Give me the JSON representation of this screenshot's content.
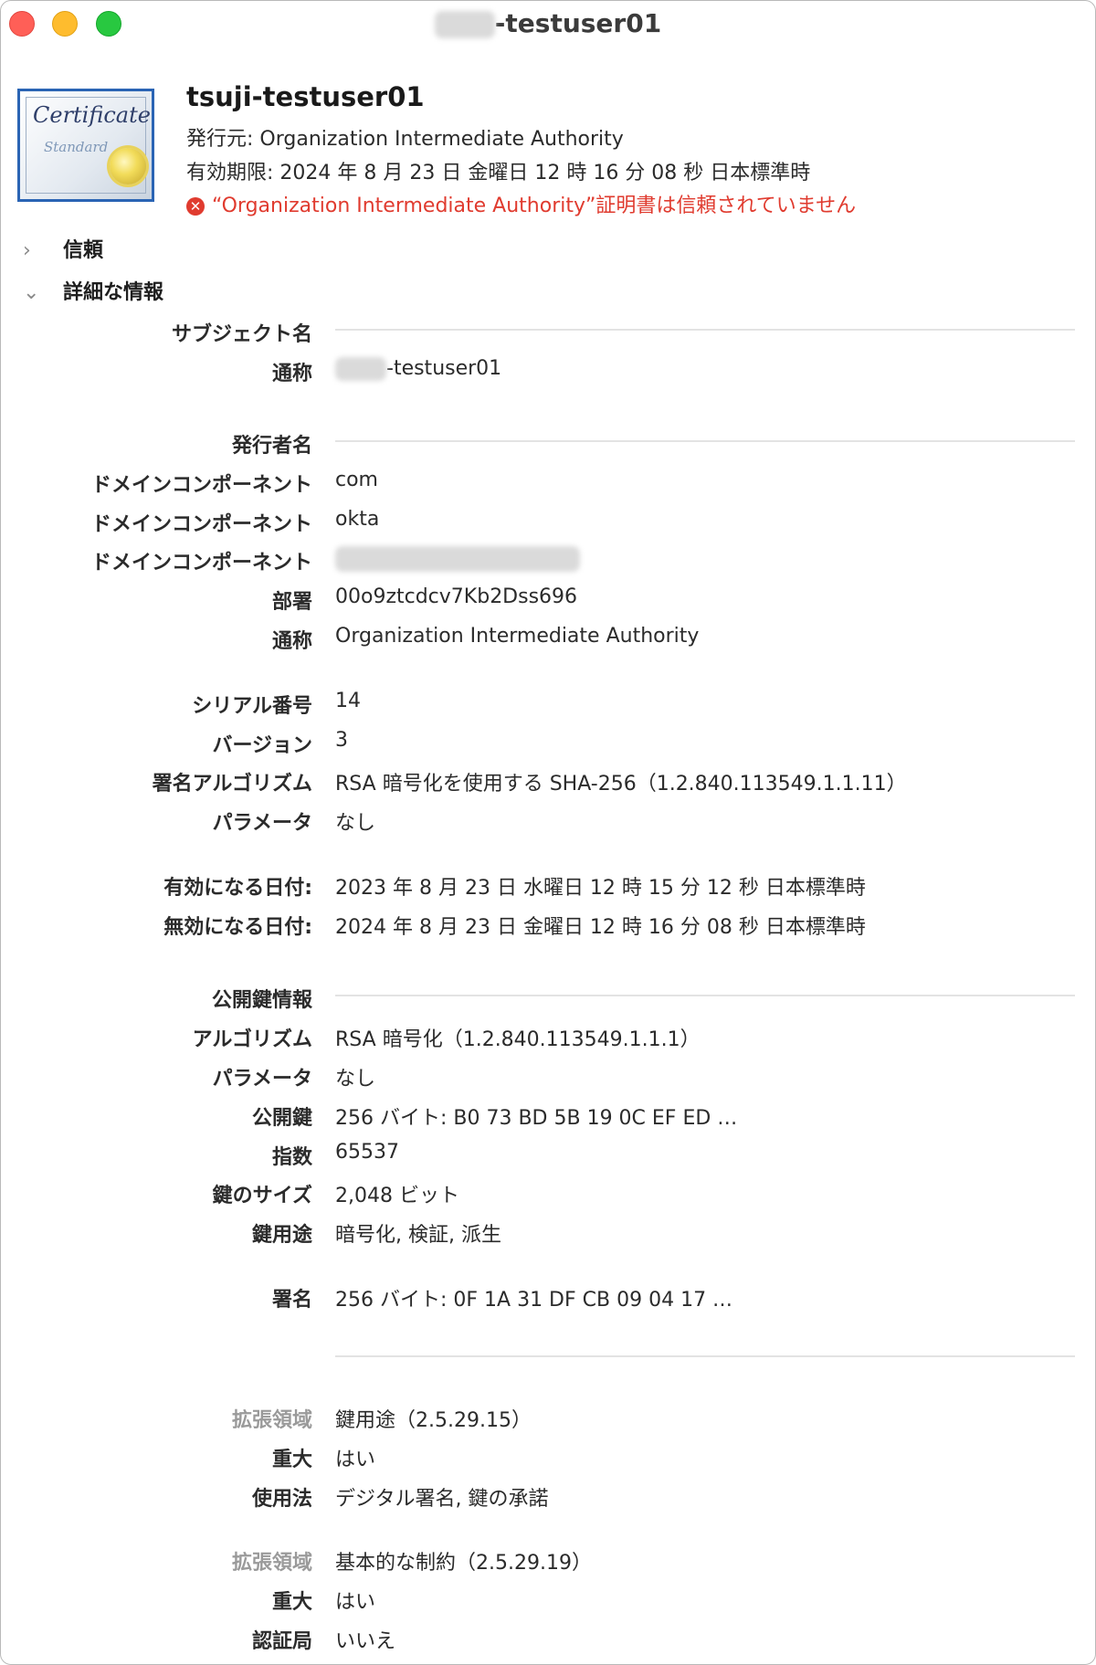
{
  "window": {
    "title_suffix": "-testuser01"
  },
  "cert_icon": {
    "word1": "Certificate",
    "word2": "Standard"
  },
  "header": {
    "name": "tsuji-testuser01",
    "issuer": "発行元: Organization Intermediate Authority",
    "expires": "有効期限: 2024 年 8 月 23 日 金曜日 12 時 16 分 08 秒 日本標準時",
    "warning": "“Organization Intermediate Authority”証明書は信頼されていません"
  },
  "sections": {
    "trust": "信頼",
    "details": "詳細な情報"
  },
  "details": {
    "subject_header": "サブジェクト名",
    "subject_cn_label": "通称",
    "subject_cn_value": "-testuser01",
    "issuer_header": "発行者名",
    "dc1_label": "ドメインコンポーネント",
    "dc1_value": "com",
    "dc2_label": "ドメインコンポーネント",
    "dc2_value": "okta",
    "dc3_label": "ドメインコンポーネント",
    "ou_label": "部署",
    "ou_value": "00o9ztcdcv7Kb2Dss696",
    "issuer_cn_label": "通称",
    "issuer_cn_value": "Organization Intermediate Authority",
    "serial_label": "シリアル番号",
    "serial_value": "14",
    "version_label": "バージョン",
    "version_value": "3",
    "sigalg_label": "署名アルゴリズム",
    "sigalg_value": "RSA 暗号化を使用する SHA-256（1.2.840.113549.1.1.11）",
    "param1_label": "パラメータ",
    "param1_value": "なし",
    "notbefore_label": "有効になる日付:",
    "notbefore_value": "2023 年 8 月 23 日 水曜日 12 時 15 分 12 秒 日本標準時",
    "notafter_label": "無効になる日付:",
    "notafter_value": "2024 年 8 月 23 日 金曜日 12 時 16 分 08 秒 日本標準時",
    "pubkey_header": "公開鍵情報",
    "algo_label": "アルゴリズム",
    "algo_value": "RSA 暗号化（1.2.840.113549.1.1.1）",
    "param2_label": "パラメータ",
    "param2_value": "なし",
    "pubkey_label": "公開鍵",
    "pubkey_value": "256 バイト: B0 73 BD 5B 19 0C EF ED …",
    "exponent_label": "指数",
    "exponent_value": "65537",
    "keysize_label": "鍵のサイズ",
    "keysize_value": "2,048 ビット",
    "keyusage_label": "鍵用途",
    "keyusage_value": "暗号化, 検証, 派生",
    "signature_label": "署名",
    "signature_value": "256 バイト: 0F 1A 31 DF CB 09 04 17 …",
    "ext1_label": "拡張領域",
    "ext1_value": "鍵用途（2.5.29.15）",
    "ext1_critical_label": "重大",
    "ext1_critical_value": "はい",
    "ext1_usage_label": "使用法",
    "ext1_usage_value": "デジタル署名, 鍵の承諾",
    "ext2_label": "拡張領域",
    "ext2_value": "基本的な制約（2.5.29.19）",
    "ext2_critical_label": "重大",
    "ext2_critical_value": "はい",
    "ext2_ca_label": "認証局",
    "ext2_ca_value": "いいえ"
  }
}
